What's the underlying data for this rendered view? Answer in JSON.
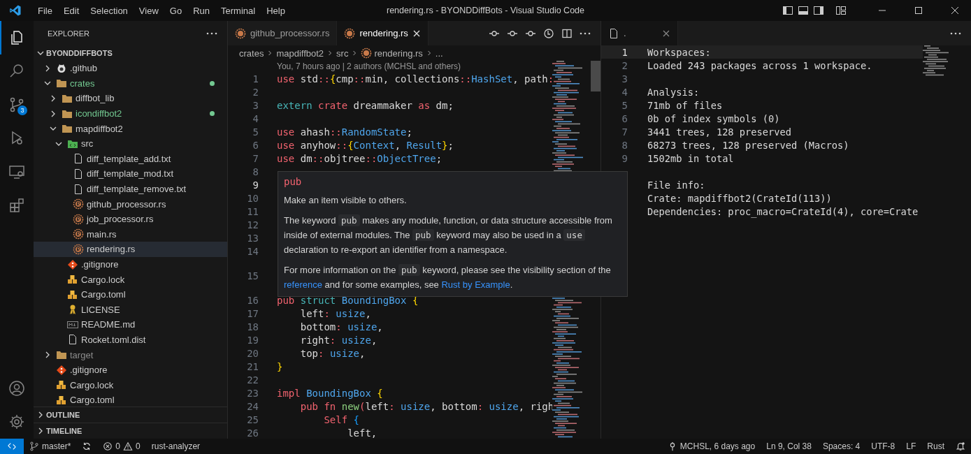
{
  "title_bar": {
    "menu": [
      "File",
      "Edit",
      "Selection",
      "View",
      "Go",
      "Run",
      "Terminal",
      "Help"
    ],
    "title": "rendering.rs - BYONDDiffBots - Visual Studio Code"
  },
  "activity_bar": {
    "items": [
      {
        "kind": "files",
        "selected": true
      },
      {
        "kind": "search",
        "selected": false
      },
      {
        "kind": "source-control",
        "selected": false,
        "badge": "3"
      },
      {
        "kind": "debug",
        "selected": false
      },
      {
        "kind": "remote",
        "selected": false
      },
      {
        "kind": "extensions",
        "selected": false
      }
    ],
    "bottom": [
      {
        "kind": "account"
      },
      {
        "kind": "gear"
      }
    ]
  },
  "sidebar": {
    "title": "EXPLORER",
    "root": "BYONDDIFFBOTS",
    "tree": [
      {
        "name": ".github",
        "kind": "github-folder",
        "expanded": false,
        "untracked": false,
        "ignored": false,
        "selected": false
      },
      {
        "name": "crates",
        "kind": "folder",
        "expanded": true,
        "untracked": true,
        "ignored": false,
        "selected": false,
        "children": [
          {
            "name": "diffbot_lib",
            "kind": "folder",
            "expanded": false,
            "untracked": false,
            "ignored": false,
            "selected": false
          },
          {
            "name": "icondiffbot2",
            "kind": "folder",
            "expanded": false,
            "untracked": true,
            "ignored": false,
            "selected": false
          },
          {
            "name": "mapdiffbot2",
            "kind": "folder",
            "expanded": true,
            "untracked": false,
            "ignored": false,
            "selected": false,
            "children": [
              {
                "name": "src",
                "kind": "src-folder",
                "expanded": true,
                "untracked": false,
                "ignored": false,
                "selected": false,
                "children": [
                  {
                    "name": "diff_template_add.txt",
                    "kind": "text-file",
                    "untracked": false,
                    "ignored": false,
                    "selected": false
                  },
                  {
                    "name": "diff_template_mod.txt",
                    "kind": "text-file",
                    "untracked": false,
                    "ignored": false,
                    "selected": false
                  },
                  {
                    "name": "diff_template_remove.txt",
                    "kind": "text-file",
                    "untracked": false,
                    "ignored": false,
                    "selected": false
                  },
                  {
                    "name": "github_processor.rs",
                    "kind": "rust-file",
                    "untracked": false,
                    "ignored": false,
                    "selected": false
                  },
                  {
                    "name": "job_processor.rs",
                    "kind": "rust-file",
                    "untracked": false,
                    "ignored": false,
                    "selected": false
                  },
                  {
                    "name": "main.rs",
                    "kind": "rust-file",
                    "untracked": false,
                    "ignored": false,
                    "selected": false
                  },
                  {
                    "name": "rendering.rs",
                    "kind": "rust-file",
                    "untracked": false,
                    "ignored": false,
                    "selected": true
                  }
                ]
              },
              {
                "name": ".gitignore",
                "kind": "git-file",
                "untracked": false,
                "ignored": false,
                "selected": false
              },
              {
                "name": "Cargo.lock",
                "kind": "cargo-file",
                "untracked": false,
                "ignored": false,
                "selected": false
              },
              {
                "name": "Cargo.toml",
                "kind": "cargo-file",
                "untracked": false,
                "ignored": false,
                "selected": false
              },
              {
                "name": "LICENSE",
                "kind": "license-file",
                "untracked": false,
                "ignored": false,
                "selected": false
              },
              {
                "name": "README.md",
                "kind": "readme-file",
                "untracked": false,
                "ignored": false,
                "selected": false
              },
              {
                "name": "Rocket.toml.dist",
                "kind": "text-file",
                "untracked": false,
                "ignored": false,
                "selected": false
              }
            ]
          }
        ]
      },
      {
        "name": "target",
        "kind": "folder",
        "expanded": false,
        "untracked": false,
        "ignored": true,
        "selected": false
      },
      {
        "name": ".gitignore",
        "kind": "git-file",
        "untracked": false,
        "ignored": false,
        "selected": false
      },
      {
        "name": "Cargo.lock",
        "kind": "cargo-file",
        "untracked": false,
        "ignored": false,
        "selected": false
      },
      {
        "name": "Cargo.toml",
        "kind": "cargo-file",
        "untracked": false,
        "ignored": false,
        "selected": false
      }
    ],
    "sections": [
      "OUTLINE",
      "TIMELINE"
    ]
  },
  "editor": {
    "tabs": [
      {
        "label": "github_processor.rs",
        "selected": false
      },
      {
        "label": "rendering.rs",
        "selected": true
      }
    ],
    "breadcrumbs": [
      "crates",
      "mapdiffbot2",
      "src",
      "rendering.rs",
      "..."
    ],
    "code_lens": "You, 7 hours ago | 2 authors (MCHSL and others)",
    "lines": [
      {
        "number": "1",
        "current": false,
        "spans": [
          {
            "kind": "kw",
            "text": "use"
          },
          {
            "kind": "id",
            "text": " std"
          },
          {
            "kind": "op",
            "text": "::"
          },
          {
            "kind": "br",
            "text": "{"
          },
          {
            "kind": "id",
            "text": "cmp"
          },
          {
            "kind": "op",
            "text": "::"
          },
          {
            "kind": "id",
            "text": "min, collections"
          },
          {
            "kind": "op",
            "text": "::"
          },
          {
            "kind": "ty",
            "text": "HashSet"
          },
          {
            "kind": "id",
            "text": ", path"
          },
          {
            "kind": "op",
            "text": ":"
          }
        ]
      },
      {
        "number": "2",
        "current": false
      },
      {
        "number": "3",
        "current": false,
        "spans": [
          {
            "kind": "tl",
            "text": "extern"
          },
          {
            "kind": "kw",
            "text": " crate"
          },
          {
            "kind": "id",
            "text": " dreammaker"
          },
          {
            "kind": "kw",
            "text": " as"
          },
          {
            "kind": "id",
            "text": " dm;"
          }
        ]
      },
      {
        "number": "4",
        "current": false
      },
      {
        "number": "5",
        "current": false,
        "spans": [
          {
            "kind": "kw",
            "text": "use"
          },
          {
            "kind": "id",
            "text": " ahash"
          },
          {
            "kind": "op",
            "text": "::"
          },
          {
            "kind": "ty",
            "text": "RandomState"
          },
          {
            "kind": "id",
            "text": ";"
          }
        ]
      },
      {
        "number": "6",
        "current": false,
        "spans": [
          {
            "kind": "kw",
            "text": "use"
          },
          {
            "kind": "id",
            "text": " anyhow"
          },
          {
            "kind": "op",
            "text": "::"
          },
          {
            "kind": "br",
            "text": "{"
          },
          {
            "kind": "ty",
            "text": "Context"
          },
          {
            "kind": "id",
            "text": ","
          },
          {
            "kind": "ty",
            "text": " Result"
          },
          {
            "kind": "br",
            "text": "}"
          },
          {
            "kind": "id",
            "text": ";"
          }
        ]
      },
      {
        "number": "7",
        "current": false,
        "spans": [
          {
            "kind": "kw",
            "text": "use"
          },
          {
            "kind": "id",
            "text": " dm"
          },
          {
            "kind": "op",
            "text": "::"
          },
          {
            "kind": "id",
            "text": "objtree"
          },
          {
            "kind": "op",
            "text": "::"
          },
          {
            "kind": "ty",
            "text": "ObjectTree"
          },
          {
            "kind": "id",
            "text": ";"
          }
        ]
      },
      {
        "number": "8",
        "current": false
      },
      {
        "number": "9",
        "current": true
      },
      {
        "number": "10",
        "current": false
      },
      {
        "number": "11",
        "current": false
      },
      {
        "number": "12",
        "current": false
      },
      {
        "number": "13",
        "current": false
      },
      {
        "number": "14",
        "current": false
      },
      {
        "number": "15",
        "current": false
      },
      {
        "number": "16",
        "current": false,
        "spans": [
          {
            "kind": "kw",
            "text": "pub"
          },
          {
            "kind": "tl",
            "text": " struct"
          },
          {
            "kind": "ty",
            "text": " BoundingBox"
          },
          {
            "kind": "br",
            "text": " {"
          }
        ]
      },
      {
        "number": "17",
        "current": false,
        "spans": [
          {
            "kind": "id",
            "text": "    left"
          },
          {
            "kind": "op",
            "text": ":"
          },
          {
            "kind": "ty",
            "text": " usize"
          },
          {
            "kind": "id",
            "text": ","
          }
        ]
      },
      {
        "number": "18",
        "current": false,
        "spans": [
          {
            "kind": "id",
            "text": "    bottom"
          },
          {
            "kind": "op",
            "text": ":"
          },
          {
            "kind": "ty",
            "text": " usize"
          },
          {
            "kind": "id",
            "text": ","
          }
        ]
      },
      {
        "number": "19",
        "current": false,
        "spans": [
          {
            "kind": "id",
            "text": "    right"
          },
          {
            "kind": "op",
            "text": ":"
          },
          {
            "kind": "ty",
            "text": " usize"
          },
          {
            "kind": "id",
            "text": ","
          }
        ]
      },
      {
        "number": "20",
        "current": false,
        "spans": [
          {
            "kind": "id",
            "text": "    top"
          },
          {
            "kind": "op",
            "text": ":"
          },
          {
            "kind": "ty",
            "text": " usize"
          },
          {
            "kind": "id",
            "text": ","
          }
        ]
      },
      {
        "number": "21",
        "current": false,
        "spans": [
          {
            "kind": "br",
            "text": "}"
          }
        ]
      },
      {
        "number": "22",
        "current": false
      },
      {
        "number": "23",
        "current": false,
        "spans": [
          {
            "kind": "kw",
            "text": "impl"
          },
          {
            "kind": "ty",
            "text": " BoundingBox"
          },
          {
            "kind": "br",
            "text": " {"
          }
        ]
      },
      {
        "number": "24",
        "current": false,
        "spans": [
          {
            "kind": "kw",
            "text": "    pub"
          },
          {
            "kind": "kw",
            "text": " fn"
          },
          {
            "kind": "fn",
            "text": " new"
          },
          {
            "kind": "pa",
            "text": "("
          },
          {
            "kind": "id",
            "text": "left"
          },
          {
            "kind": "op",
            "text": ":"
          },
          {
            "kind": "ty",
            "text": " usize"
          },
          {
            "kind": "id",
            "text": ", bottom"
          },
          {
            "kind": "op",
            "text": ":"
          },
          {
            "kind": "ty",
            "text": " usize"
          },
          {
            "kind": "id",
            "text": ", righ"
          }
        ]
      },
      {
        "number": "25",
        "current": false,
        "spans": [
          {
            "kind": "kw",
            "text": "        Self"
          },
          {
            "kind": "b2",
            "text": " {"
          }
        ]
      },
      {
        "number": "26",
        "current": false,
        "spans": [
          {
            "kind": "id",
            "text": "            left,"
          }
        ]
      }
    ]
  },
  "side_editor": {
    "tabs": [
      {
        "label": ".",
        "selected": true
      }
    ],
    "lines": [
      {
        "number": "1",
        "current": true,
        "text": "Workspaces:"
      },
      {
        "number": "2",
        "current": false,
        "text": "Loaded 243 packages across 1 workspace."
      },
      {
        "number": "3",
        "current": false
      },
      {
        "number": "4",
        "current": false,
        "text": "Analysis:"
      },
      {
        "number": "5",
        "current": false,
        "text": "71mb of files"
      },
      {
        "number": "6",
        "current": false,
        "text": "0b of index symbols (0)"
      },
      {
        "number": "7",
        "current": false,
        "text": "3441 trees, 128 preserved"
      },
      {
        "number": "8",
        "current": false,
        "text": "68273 trees, 128 preserved (Macros)"
      },
      {
        "number": "9",
        "current": false,
        "text": "1502mb in total"
      },
      {
        "current": false
      },
      {
        "current": false,
        "text": "File info:"
      },
      {
        "current": false,
        "text": "Crate: mapdiffbot2(CrateId(113))"
      },
      {
        "current": false,
        "text": "Dependencies: proc_macro=CrateId(4), core=Crate"
      }
    ]
  },
  "hover": {
    "title": "pub",
    "paragraphs": [
      [
        {
          "kind": "text",
          "text": "Make an item visible to others."
        }
      ],
      [
        {
          "kind": "text",
          "text": "The keyword "
        },
        {
          "kind": "code",
          "text": "pub"
        },
        {
          "kind": "text",
          "text": " makes any module, function, or data structure accessible from inside of external modules. The "
        },
        {
          "kind": "code",
          "text": "pub"
        },
        {
          "kind": "text",
          "text": " keyword may also be used in a "
        },
        {
          "kind": "code",
          "text": "use"
        },
        {
          "kind": "text",
          "text": " declaration to re-export an identifier from a namespace."
        }
      ],
      [
        {
          "kind": "text",
          "text": "For more information on the "
        },
        {
          "kind": "code",
          "text": "pub"
        },
        {
          "kind": "text",
          "text": " keyword, please see the visibility section of the "
        },
        {
          "kind": "link",
          "text": "reference"
        },
        {
          "kind": "text",
          "text": " and for some examples, see "
        },
        {
          "kind": "link",
          "text": "Rust by Example"
        },
        {
          "kind": "text",
          "text": "."
        }
      ]
    ]
  },
  "status_bar": {
    "branch": "master*",
    "errors": "0",
    "warnings": "0",
    "left_items": [
      "rust-analyzer"
    ],
    "blame": "MCHSL, 6 days ago",
    "right_items": [
      "Ln 9, Col 38",
      "Spaces: 4",
      "UTF-8",
      "LF",
      "Rust"
    ]
  }
}
